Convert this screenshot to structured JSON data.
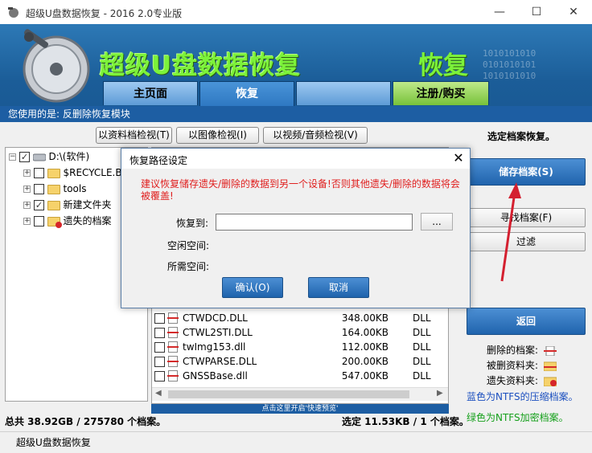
{
  "window": {
    "title": "超级U盘数据恢复 - 2016 2.0专业版",
    "minimize": "—",
    "maximize": "☐",
    "close": "✕"
  },
  "banner": {
    "brand": "超级U盘数据恢复",
    "brand_overlay": "恢复",
    "binary": "1010101010\n0101010101\n1010101010"
  },
  "tabs": [
    {
      "label": "主页面"
    },
    {
      "label": "恢复"
    },
    {
      "label": ""
    },
    {
      "label": "注册/购买"
    }
  ],
  "module_bar": "您使用的是: 反删除恢复模块",
  "toolbar": {
    "doc_check": "以资料档检视(T)",
    "image_check": "以图像检视(I)",
    "video_check": "以视频/音频检视(V)"
  },
  "right_panel": {
    "select_title": "选定档案恢复。",
    "save": "储存档案(S)",
    "find": "寻找档案(F)",
    "filter": "过滤",
    "back": "返回",
    "legend_deleted": "删除的档案:",
    "legend_deleted_folder": "被删资料夹:",
    "legend_lost_folder": "遗失资料夹:",
    "legend_blue": "蓝色为NTFS的压缩档案。",
    "legend_green": "绿色为NTFS加密档案。",
    "legend_blue_color": "#1b4fbf",
    "legend_green_color": "#16a01c"
  },
  "tree": {
    "root": "D:\\(软件)",
    "items": [
      {
        "label": "$RECYCLE.BIN"
      },
      {
        "label": "tools"
      },
      {
        "label": "新建文件夹"
      },
      {
        "label": "遗失的档案"
      }
    ]
  },
  "files": [
    {
      "name": "CTWDCD.DLL",
      "size": "348.00KB",
      "type": "DLL"
    },
    {
      "name": "CTWL2STI.DLL",
      "size": "164.00KB",
      "type": "DLL"
    },
    {
      "name": "twImg153.dll",
      "size": "112.00KB",
      "type": "DLL"
    },
    {
      "name": "CTWPARSE.DLL",
      "size": "200.00KB",
      "type": "DLL"
    },
    {
      "name": "GNSSBase.dll",
      "size": "547.00KB",
      "type": "DLL"
    }
  ],
  "hint": "点击这里开启'快速预览'",
  "dialog": {
    "title": "恢复路径设定",
    "close": "✕",
    "warning": "建议恢复储存遗失/删除的数据到另一个设备!否则其他遗失/删除的数据将会被覆盖!",
    "restore_to": "恢复到:",
    "free_space": "空闲空间:",
    "required_space": "所需空间:",
    "path_value": "",
    "browse": "...",
    "ok": "确认(O)",
    "cancel": "取消"
  },
  "status": {
    "total": "总共 38.92GB / 275780 个档案。",
    "selected": "选定 11.53KB / 1 个档案。"
  },
  "statusbar": "超级U盘数据恢复",
  "colors": {
    "accent_blue": "#1d5ea3",
    "brand_green": "#7cf23a",
    "warning_red": "#e0201f"
  }
}
